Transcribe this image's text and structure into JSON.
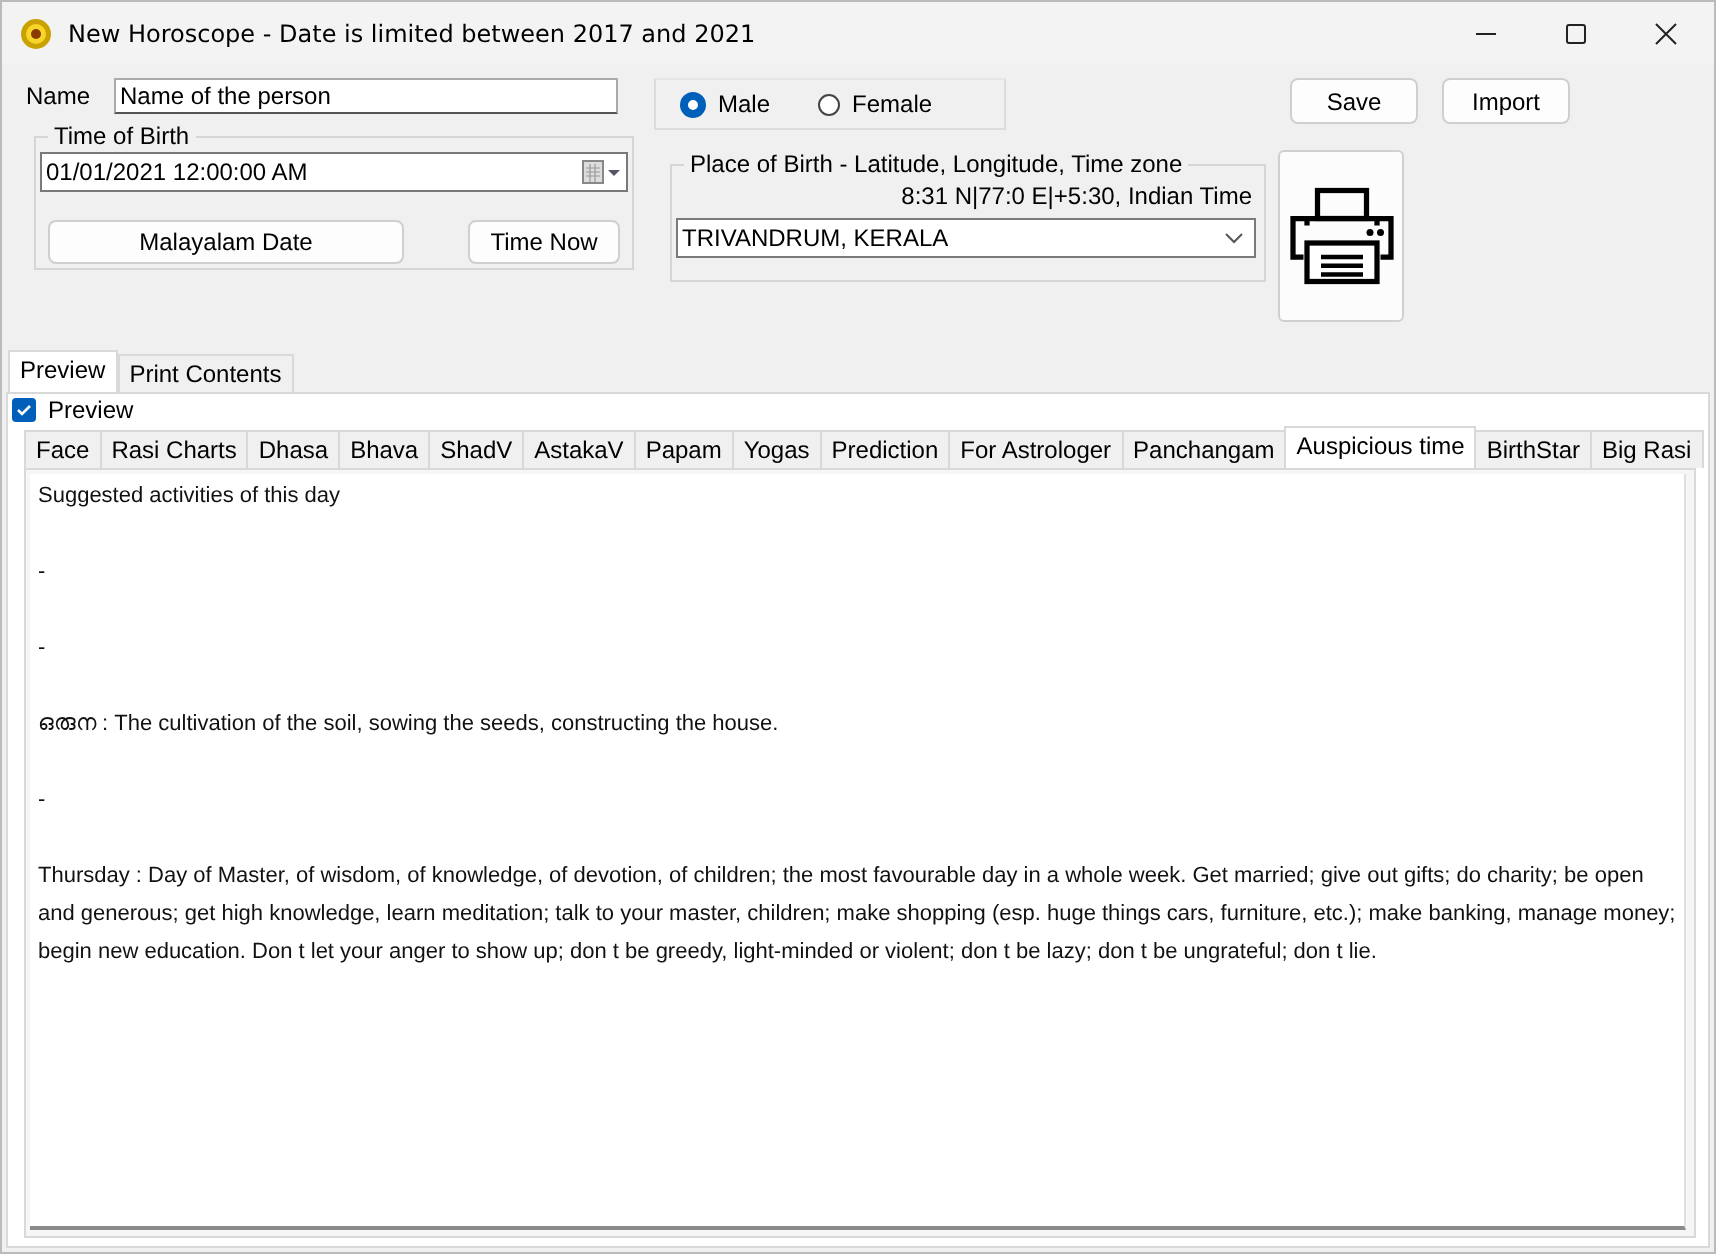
{
  "window": {
    "title": "New Horoscope - Date is limited between 2017 and 2021"
  },
  "name": {
    "label": "Name",
    "value": "Name of the person"
  },
  "gender": [
    {
      "label": "Male",
      "selected": true
    },
    {
      "label": "Female",
      "selected": false
    }
  ],
  "actions": [
    "Save",
    "Import"
  ],
  "time_of_birth": {
    "title": "Time of Birth",
    "value": "01/01/2021  12:00:00 AM",
    "buttons": [
      "Malayalam Date",
      "Time Now"
    ]
  },
  "place_of_birth": {
    "title": "Place of Birth - Latitude, Longitude, Time zone",
    "coordinates": "8:31 N|77:0 E|+5:30, Indian Time",
    "value": "TRIVANDRUM, KERALA"
  },
  "outer_tabs": [
    {
      "label": "Preview",
      "selected": true
    },
    {
      "label": "Print Contents",
      "selected": false
    }
  ],
  "preview_checkbox": {
    "label": "Preview",
    "checked": true
  },
  "tabs": [
    {
      "label": "Face",
      "selected": false
    },
    {
      "label": "Rasi Charts",
      "selected": false
    },
    {
      "label": "Dhasa",
      "selected": false
    },
    {
      "label": "Bhava",
      "selected": false
    },
    {
      "label": "ShadV",
      "selected": false
    },
    {
      "label": "AstakaV",
      "selected": false
    },
    {
      "label": "Papam",
      "selected": false
    },
    {
      "label": "Yogas",
      "selected": false
    },
    {
      "label": "Prediction",
      "selected": false
    },
    {
      "label": "For Astrologer",
      "selected": false
    },
    {
      "label": "Panchangam",
      "selected": false
    },
    {
      "label": "Auspicious time",
      "selected": true
    },
    {
      "label": "BirthStar",
      "selected": false
    },
    {
      "label": "Big Rasi",
      "selected": false
    }
  ],
  "content": [
    "Suggested activities of this day",
    "-",
    "-",
    "ഒരുന : The cultivation of the soil, sowing the seeds, constructing the house.",
    "-",
    "Thursday : Day of Master, of wisdom, of knowledge, of devotion, of children; the most favourable day in a whole week. Get married; give out gifts; do charity; be open and generous; get high knowledge, learn meditation; talk to your master, children; make shopping (esp. huge things cars, furniture, etc.); make banking, manage money; begin new education. Don t let your anger to show up; don t be greedy, light-minded or violent; don t be lazy; don t be ungrateful; don t lie."
  ]
}
